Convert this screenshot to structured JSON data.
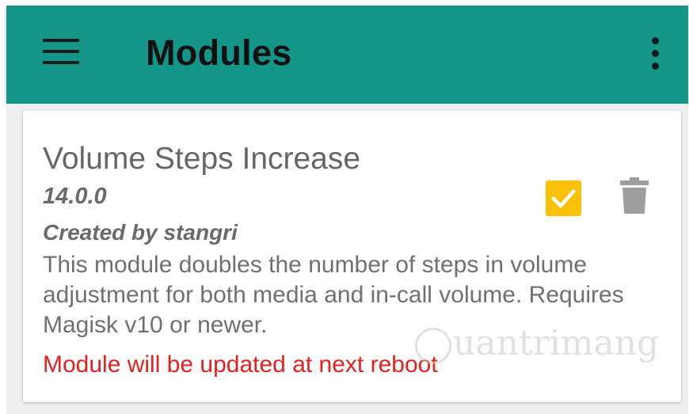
{
  "appbar": {
    "title": "Modules",
    "menu_icon": "hamburger-menu-icon",
    "overflow_icon": "more-vert-icon",
    "color": "#139688"
  },
  "module": {
    "name": "Volume Steps Increase",
    "version": "14.0.0",
    "author": "Created by stangri",
    "description": "This module doubles the number of steps in volume adjustment for both media and in-call volume. Requires Magisk v10 or newer.",
    "notice": "Module will be updated at next reboot",
    "enabled": true,
    "checkbox_icon": "check-icon",
    "delete_icon": "trash-icon",
    "checkbox_color": "#fbc107",
    "notice_color": "#e8201d"
  },
  "watermark": {
    "text": "uantrimang"
  }
}
